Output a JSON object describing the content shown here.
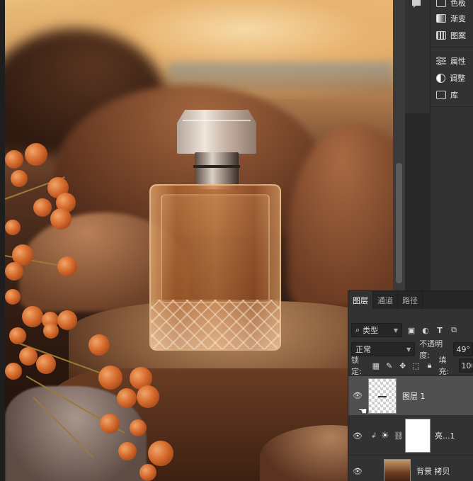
{
  "side_panel": {
    "items": [
      {
        "label": "色板",
        "icon": "swatches-icon"
      },
      {
        "label": "渐变",
        "icon": "gradient-icon"
      },
      {
        "label": "图案",
        "icon": "patterns-icon"
      },
      {
        "label": "属性",
        "icon": "properties-icon"
      },
      {
        "label": "调整",
        "icon": "adjustments-icon"
      },
      {
        "label": "库",
        "icon": "libraries-icon"
      }
    ]
  },
  "layers_panel": {
    "tabs": [
      {
        "label": "图层",
        "active": true
      },
      {
        "label": "通道",
        "active": false
      },
      {
        "label": "路径",
        "active": false
      }
    ],
    "filter_kind": "类型",
    "blend_mode": "正常",
    "opacity_label": "不透明度:",
    "opacity_value": "49°",
    "lock_label": "锁定:",
    "fill_label": "填充:",
    "fill_value": "100",
    "layers": [
      {
        "name": "图层 1",
        "selected": true,
        "thumb": "transparent"
      },
      {
        "name": "亮...1",
        "selected": false,
        "thumb": "white-mask",
        "adjustment": "brightness-icon"
      },
      {
        "name": "背景 拷贝",
        "selected": false,
        "thumb": "photo"
      }
    ]
  },
  "colors": {
    "panel_bg": "#323232",
    "tab_bar_bg": "#262626",
    "selected_layer_bg": "#505050"
  }
}
